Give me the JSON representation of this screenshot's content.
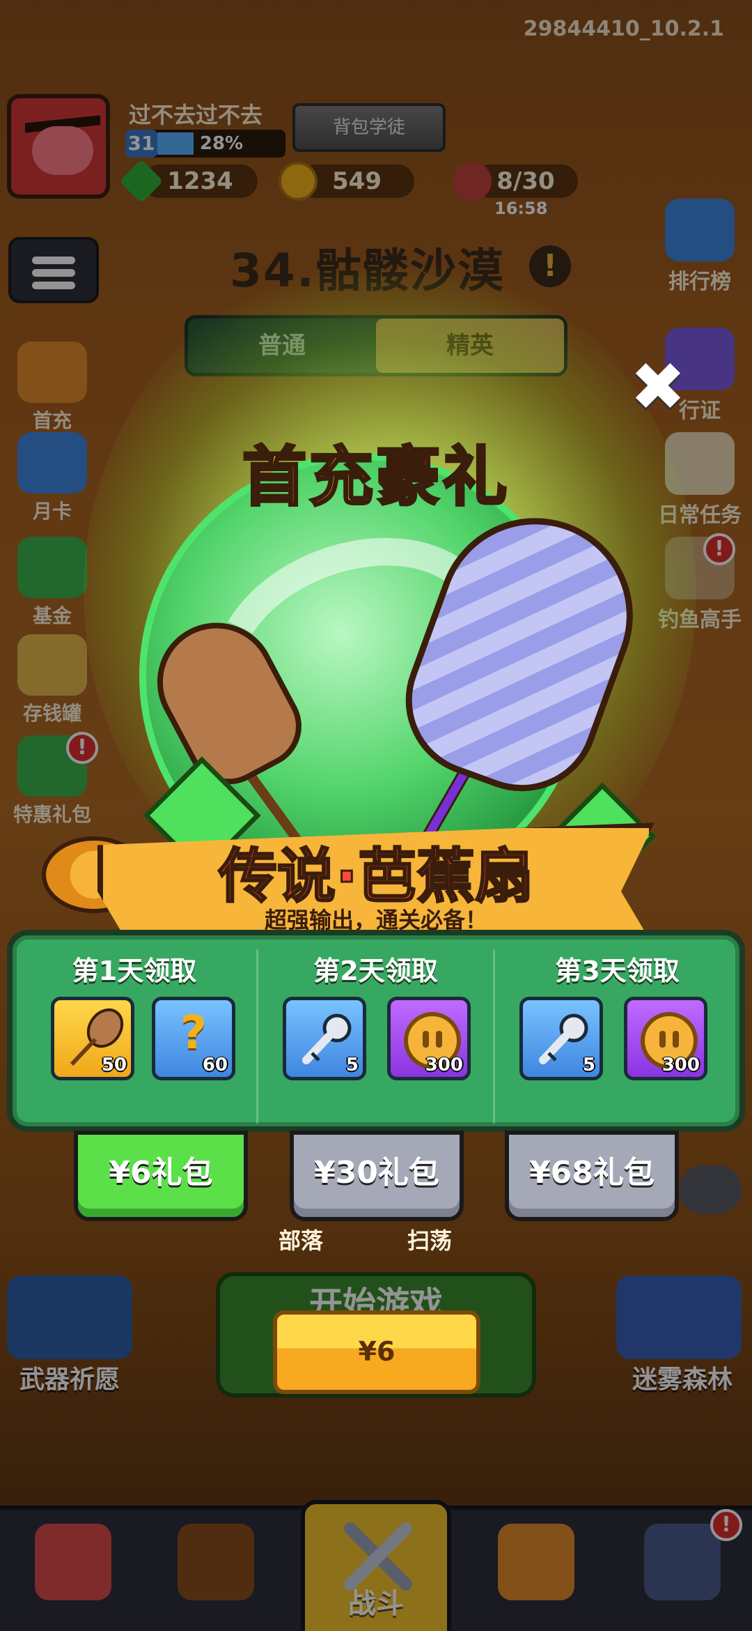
{
  "version_label": "29844410_10.2.1",
  "player": {
    "name": "过不去过不去",
    "level": "31",
    "progress_text": "28%",
    "progress": 0.28,
    "rank_title": "背包学徒"
  },
  "resources": {
    "gems": "1234",
    "coins": "549",
    "stamina": "8/30",
    "stamina_timer": "16:58"
  },
  "stage": {
    "title": "34.骷髅沙漠",
    "info_mark": "!",
    "tabs": [
      {
        "label": "普通"
      },
      {
        "label": "精英"
      }
    ]
  },
  "left_menu": [
    {
      "label": "首充"
    },
    {
      "label": "月卡"
    },
    {
      "label": "基金"
    },
    {
      "label": "存钱罐"
    },
    {
      "label": "特惠礼包"
    }
  ],
  "right_menu": [
    {
      "label": "排行榜"
    },
    {
      "label": "行证"
    },
    {
      "label": "日常任务"
    },
    {
      "label": "钓鱼高手"
    }
  ],
  "badge_mark": "!",
  "bottom": {
    "weapon_wish": "武器祈愿",
    "fog_forest": "迷雾森林",
    "start_game": "开始游戏",
    "tribe": "部落",
    "sweep": "扫荡",
    "nav_battle": "战斗"
  },
  "popup": {
    "close_symbol": "✖",
    "title_part1": "首充",
    "title_part2": "豪礼",
    "item_title": "传说·芭蕉扇",
    "item_subtitle": "超强输出，通关必备！",
    "days": [
      {
        "title": "第1天领取",
        "items": [
          {
            "icon": "fan-icon",
            "count": "50"
          },
          {
            "icon": "mystery-box-icon",
            "glyph": "?",
            "count": "60"
          }
        ]
      },
      {
        "title": "第2天领取",
        "items": [
          {
            "icon": "key-icon",
            "count": "5"
          },
          {
            "icon": "coin-icon",
            "count": "300"
          }
        ]
      },
      {
        "title": "第3天领取",
        "items": [
          {
            "icon": "key-icon",
            "count": "5"
          },
          {
            "icon": "coin-icon",
            "count": "300"
          }
        ]
      }
    ],
    "packages": [
      {
        "label": "¥6礼包",
        "selected": true
      },
      {
        "label": "¥30礼包",
        "selected": false
      },
      {
        "label": "¥68礼包",
        "selected": false
      }
    ],
    "buy_label": "¥6"
  },
  "colors": {
    "accent_green": "#5ce04a",
    "panel_green": "#37a861",
    "buy_yellow": "#f7a91f",
    "title_red": "#ff4b3a"
  }
}
